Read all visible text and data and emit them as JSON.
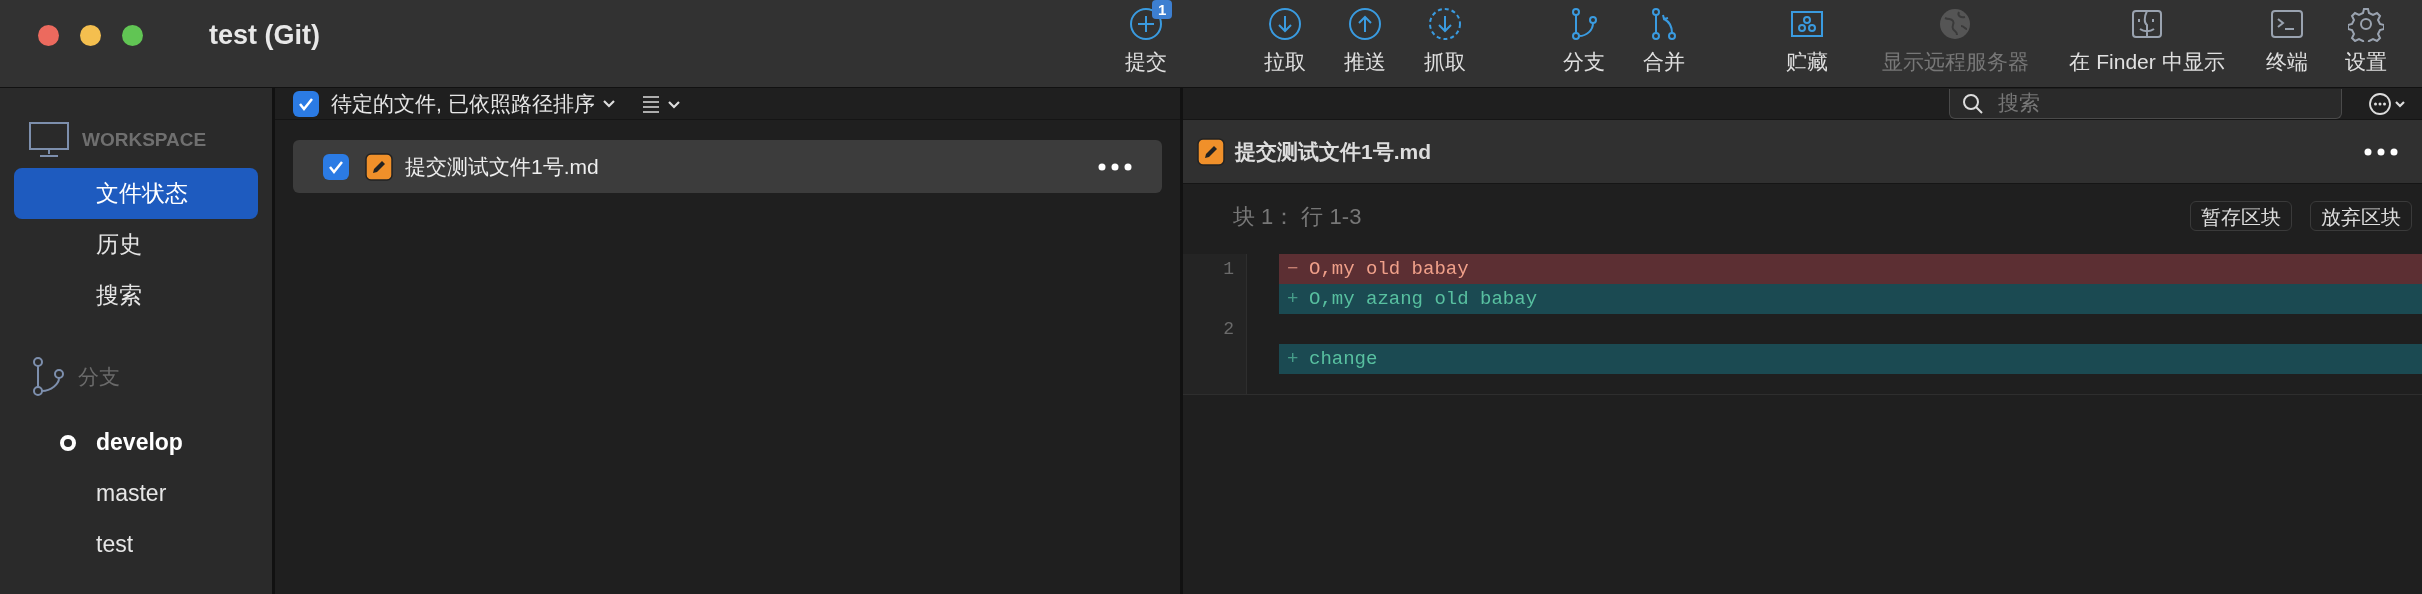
{
  "window": {
    "title": "test (Git)"
  },
  "toolbar": [
    {
      "kind": "commit",
      "label": "提交",
      "badge": "1",
      "disabled": false
    },
    {
      "kind": "pull",
      "label": "拉取",
      "disabled": false
    },
    {
      "kind": "push",
      "label": "推送",
      "disabled": false
    },
    {
      "kind": "fetch",
      "label": "抓取",
      "disabled": false
    },
    {
      "kind": "branch",
      "label": "分支",
      "disabled": false
    },
    {
      "kind": "merge",
      "label": "合并",
      "disabled": false
    },
    {
      "kind": "stash",
      "label": "贮藏",
      "disabled": false
    },
    {
      "kind": "remote",
      "label": "显示远程服务器",
      "disabled": true
    },
    {
      "kind": "finder",
      "label": "在 Finder 中显示",
      "disabled": false
    },
    {
      "kind": "terminal",
      "label": "终端",
      "disabled": false
    },
    {
      "kind": "settings",
      "label": "设置",
      "disabled": false
    }
  ],
  "sidebar": {
    "workspace_header": "WORKSPACE",
    "items": [
      {
        "label": "文件状态",
        "selected": true
      },
      {
        "label": "历史",
        "selected": false
      },
      {
        "label": "搜索",
        "selected": false
      }
    ],
    "branches_header": "分支",
    "branches": [
      {
        "label": "develop",
        "current": true
      },
      {
        "label": "master",
        "current": false
      },
      {
        "label": "test",
        "current": false
      }
    ]
  },
  "file_list": {
    "all_checked": true,
    "sort_label": "待定的文件, 已依照路径排序",
    "files": [
      {
        "name": "提交测试文件1号.md",
        "checked": true,
        "selected": true
      }
    ]
  },
  "diff": {
    "search": {
      "placeholder": "搜索"
    },
    "file_name": "提交测试文件1号.md",
    "hunk_title": "块 1： 行 1-3",
    "hunk_buttons": [
      "暂存区块",
      "放弃区块"
    ],
    "lines": [
      {
        "kind": "removed",
        "number": "1",
        "sign": "−",
        "text": "O,my old babay"
      },
      {
        "kind": "added",
        "sign": "+",
        "text": "O,my azang old babay"
      },
      {
        "kind": "context",
        "number": "2"
      },
      {
        "kind": "added",
        "sign": "+",
        "text": "change"
      }
    ]
  }
}
